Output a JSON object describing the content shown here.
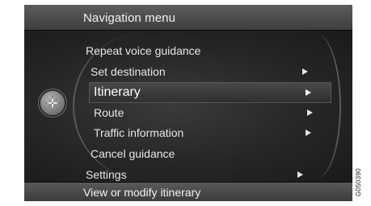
{
  "header": {
    "title": "Navigation menu"
  },
  "menu": {
    "items": [
      {
        "label": "Repeat voice guidance",
        "has_arrow": false,
        "selected": false
      },
      {
        "label": "Set destination",
        "has_arrow": true,
        "selected": false
      },
      {
        "label": "Itinerary",
        "has_arrow": true,
        "selected": true
      },
      {
        "label": "Route",
        "has_arrow": true,
        "selected": false
      },
      {
        "label": "Traffic information",
        "has_arrow": true,
        "selected": false
      },
      {
        "label": "Cancel guidance",
        "has_arrow": false,
        "selected": false
      },
      {
        "label": "Settings",
        "has_arrow": true,
        "selected": false
      }
    ]
  },
  "footer": {
    "status": "View or modify itinerary"
  },
  "figure_code": "G050390",
  "icons": {
    "nav_button": "compass-icon",
    "submenu_arrow": "chevron-right-icon"
  },
  "colors": {
    "background": "#141414",
    "text": "#e6e6e6",
    "highlight": "#4a4a4a"
  }
}
